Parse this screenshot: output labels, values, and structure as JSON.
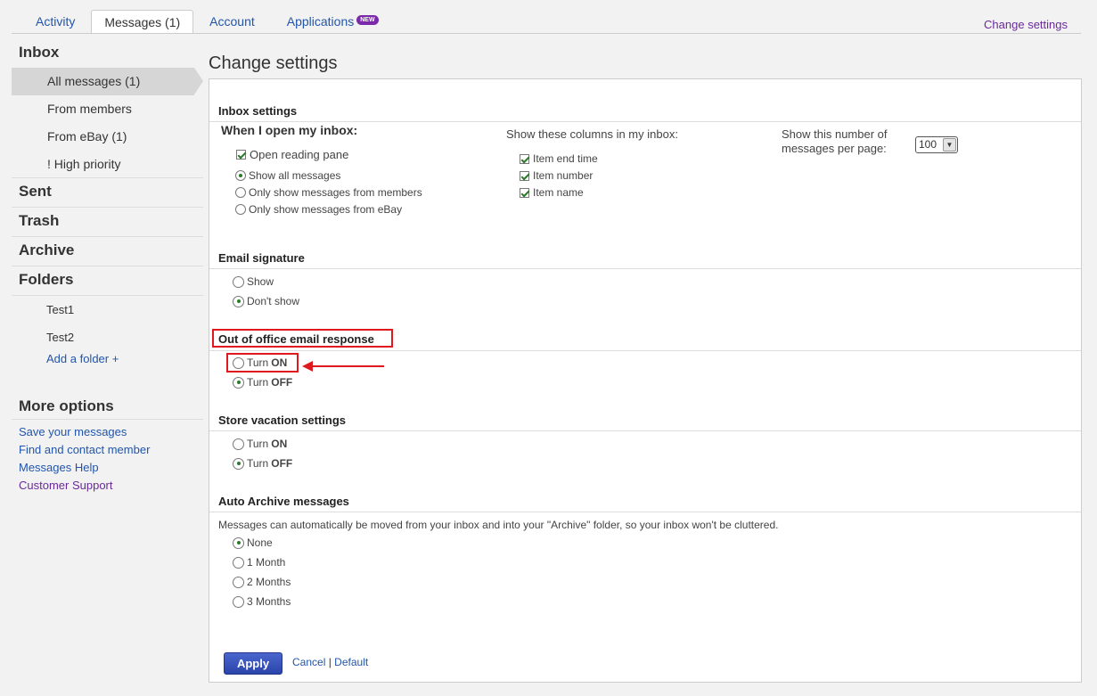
{
  "tabs": [
    {
      "label": "Activity"
    },
    {
      "label": "Messages (1)"
    },
    {
      "label": "Account"
    },
    {
      "label": "Applications",
      "badge": "NEW"
    }
  ],
  "top_right_link": "Change settings",
  "sidebar": {
    "inbox": "Inbox",
    "inbox_items": [
      "All messages (1)",
      "From members",
      "From eBay (1)",
      "! High priority"
    ],
    "sent": "Sent",
    "trash": "Trash",
    "archive": "Archive",
    "folders": "Folders",
    "folder_items": [
      "Test1",
      "Test2"
    ],
    "add_folder": "Add a folder +",
    "more_options": "More options",
    "links": [
      "Save your messages",
      "Find and contact member",
      "Messages Help",
      "Customer Support"
    ]
  },
  "page_title": "Change settings",
  "inbox_settings": {
    "heading": "Inbox settings",
    "when_open_label": "When I open my inbox:",
    "open_reading_pane": {
      "label": "Open reading pane",
      "checked": true
    },
    "show_options": [
      {
        "label": "Show all messages",
        "selected": true
      },
      {
        "label": "Only show messages from members",
        "selected": false
      },
      {
        "label": "Only show messages from eBay",
        "selected": false
      }
    ],
    "columns_label": "Show these columns in my inbox:",
    "columns": [
      {
        "label": "Item end time",
        "checked": true
      },
      {
        "label": "Item number",
        "checked": true
      },
      {
        "label": "Item name",
        "checked": true
      }
    ],
    "per_page_label_1": "Show this number of",
    "per_page_label_2": "messages per page:",
    "per_page_value": "100"
  },
  "email_signature": {
    "heading": "Email signature",
    "options": [
      {
        "label": "Show",
        "selected": false
      },
      {
        "label": "Don't show",
        "selected": true
      }
    ]
  },
  "out_of_office": {
    "heading": "Out of office email response",
    "options": [
      {
        "prefix": "Turn",
        "strong": "ON",
        "selected": false
      },
      {
        "prefix": "Turn",
        "strong": "OFF",
        "selected": true
      }
    ]
  },
  "vacation": {
    "heading": "Store vacation settings",
    "options": [
      {
        "prefix": "Turn",
        "strong": "ON",
        "selected": false
      },
      {
        "prefix": "Turn",
        "strong": "OFF",
        "selected": true
      }
    ]
  },
  "auto_archive": {
    "heading": "Auto Archive messages",
    "description": "Messages can automatically be moved from your inbox and into your \"Archive\" folder, so your inbox won't be cluttered.",
    "options": [
      {
        "label": "None",
        "selected": true
      },
      {
        "label": "1 Month",
        "selected": false
      },
      {
        "label": "2 Months",
        "selected": false
      },
      {
        "label": "3 Months",
        "selected": false
      }
    ]
  },
  "actions": {
    "apply": "Apply",
    "cancel": "Cancel",
    "separator": "|",
    "default": "Default"
  },
  "colors": {
    "highlight": "#e0191f",
    "link": "#2255aa",
    "visited_link": "#6a2a9a"
  }
}
